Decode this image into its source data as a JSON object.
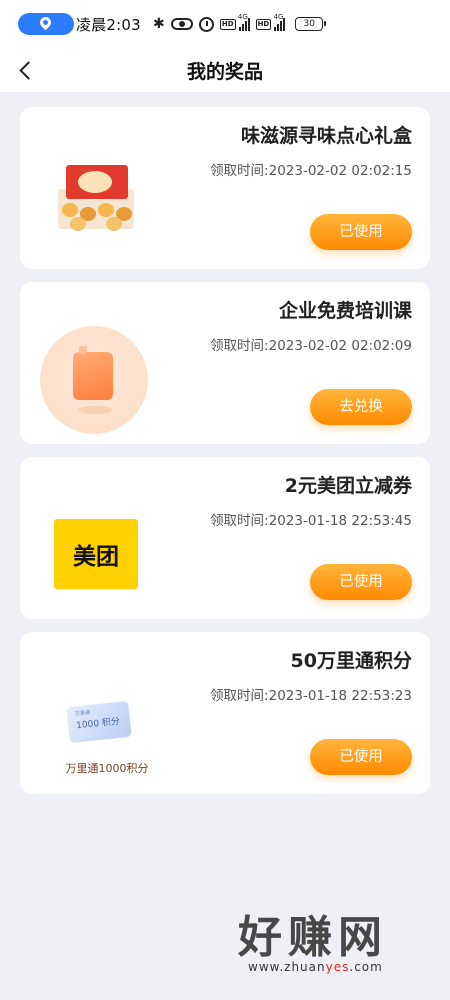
{
  "status_bar": {
    "time": "凌晨2:03",
    "battery": "30",
    "network_1": "HD 4G",
    "network_2": "HD 4G"
  },
  "nav": {
    "title": "我的奖品"
  },
  "prizes": [
    {
      "name": "味滋源寻味点心礼盒",
      "time": "领取时间:2023-02-02 02:02:15",
      "button": "已使用",
      "icon": "gift-box-image"
    },
    {
      "name": "企业免费培训课",
      "time": "领取时间:2023-02-02 02:02:09",
      "button": "去兑换",
      "icon": "training-course-image"
    },
    {
      "name": "2元美团立减券",
      "time": "领取时间:2023-01-18 22:53:45",
      "button": "已使用",
      "icon": "meituan-logo",
      "logo_text": "美团"
    },
    {
      "name": "50万里通积分",
      "time": "领取时间:2023-01-18 22:53:23",
      "button": "已使用",
      "icon": "points-card-image",
      "card_text": "1000 积分",
      "card_small_text": "万里通",
      "caption": "万里通1000积分"
    }
  ],
  "watermark": {
    "title": "好赚网",
    "url_prefix": "www.zhuan",
    "url_highlight": "yes",
    "url_suffix": ".com"
  },
  "colors": {
    "button_gradient_top": "#ffb53d",
    "button_gradient_bottom": "#ff8a00",
    "page_bg": "#eef0f5",
    "status_pill": "#2b7cff",
    "meituan_yellow": "#ffd100"
  }
}
